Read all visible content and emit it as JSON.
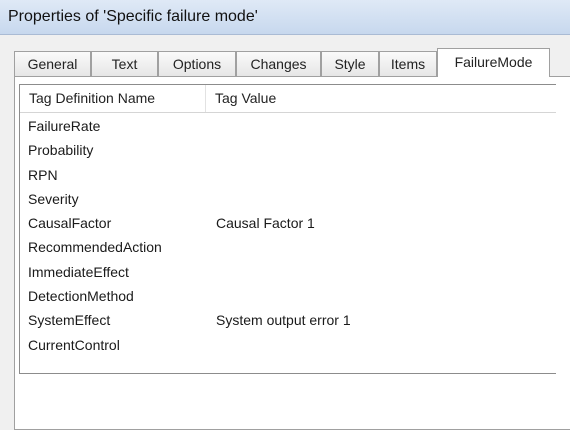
{
  "window": {
    "title": "Properties of 'Specific failure mode'"
  },
  "tabs": [
    {
      "label": "General"
    },
    {
      "label": "Text"
    },
    {
      "label": "Options"
    },
    {
      "label": "Changes"
    },
    {
      "label": "Style"
    },
    {
      "label": "Items"
    },
    {
      "label": "FailureMode",
      "selected": true
    }
  ],
  "table": {
    "columns": [
      "Tag Definition Name",
      "Tag Value"
    ],
    "rows": [
      {
        "name": "FailureRate",
        "value": ""
      },
      {
        "name": "Probability",
        "value": ""
      },
      {
        "name": "RPN",
        "value": ""
      },
      {
        "name": "Severity",
        "value": ""
      },
      {
        "name": "CausalFactor",
        "value": "Causal Factor 1"
      },
      {
        "name": "RecommendedAction",
        "value": ""
      },
      {
        "name": "ImmediateEffect",
        "value": ""
      },
      {
        "name": "DetectionMethod",
        "value": ""
      },
      {
        "name": "SystemEffect",
        "value": "System output error 1"
      },
      {
        "name": "CurrentControl",
        "value": ""
      }
    ]
  }
}
